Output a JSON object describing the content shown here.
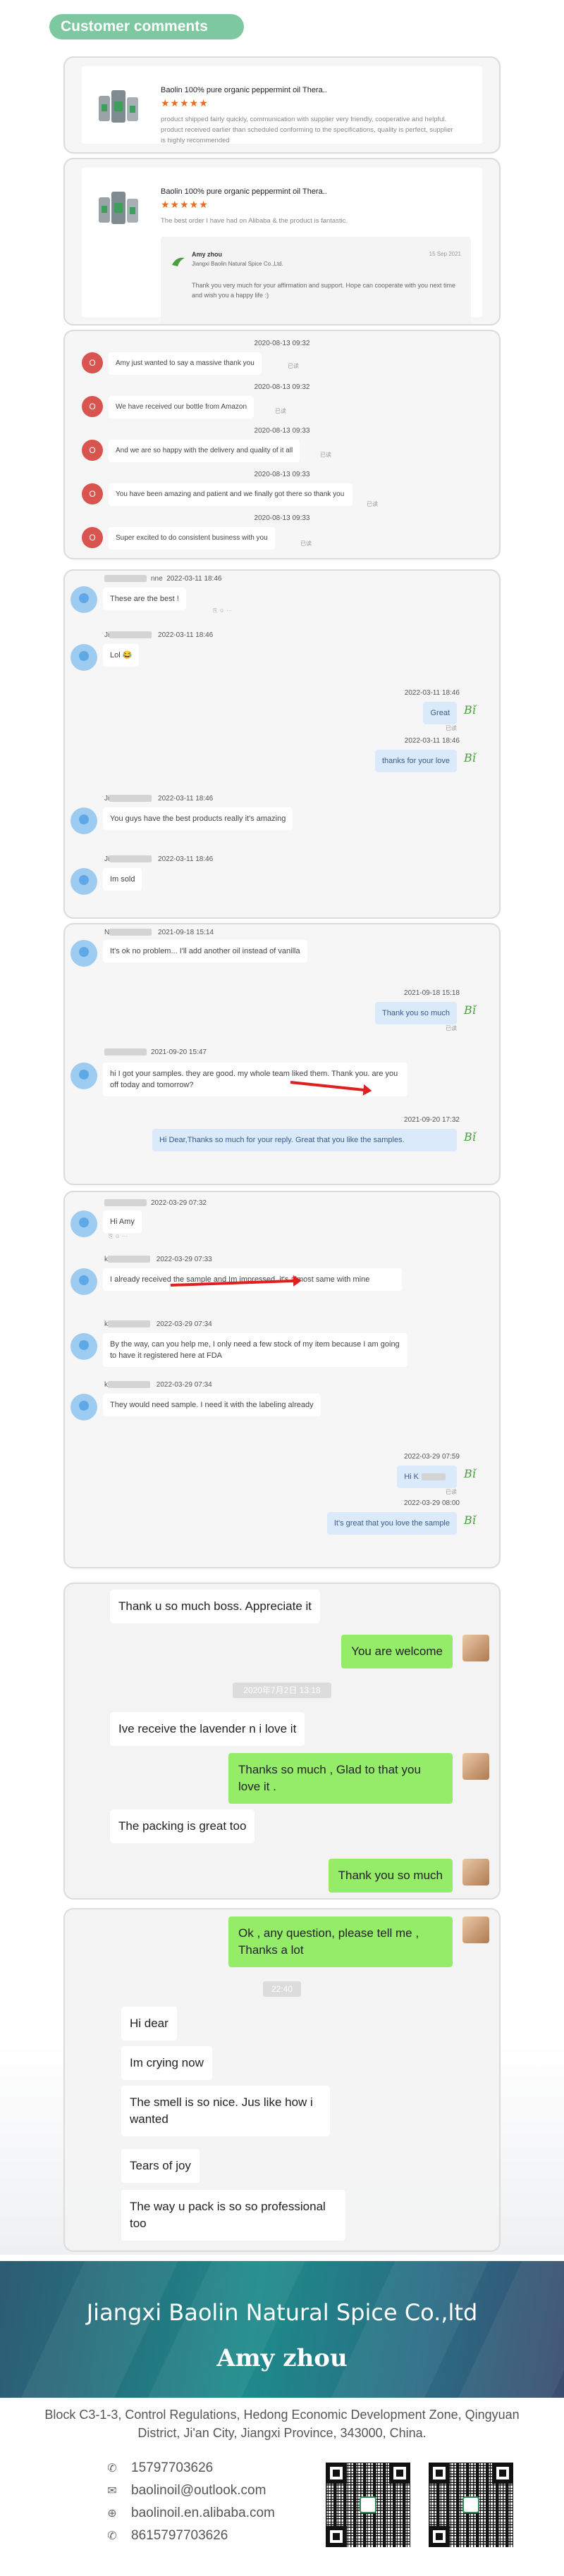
{
  "header": {
    "title": "Customer comments"
  },
  "reviews": [
    {
      "product": "Baolin 100% pure organic peppermint oil Thera..",
      "stars": "★★★★★",
      "text": "product shipped fairly quickly, communication with supplier very friendly, cooperative and helpful. product received earlier than scheduled conforming to the specifications, quality is perfect, supplier is highly recommended"
    },
    {
      "product": "Baolin 100% pure organic peppermint oil Thera..",
      "stars": "★★★★★",
      "text": "The best order I have had on Alibaba & the product is fantastic.",
      "reply": {
        "name": "Amy zhou",
        "company": "Jiangxi Baolin Natural Spice Co.,Ltd.",
        "date": "15 Sep 2021",
        "text": "Thank you very much for your affirmation and support. Hope can cooperate with you next time and wish you a happy life :)"
      }
    }
  ],
  "chat1": {
    "avatar_letter": "O",
    "read_label": "已读",
    "messages": [
      {
        "time": "2020-08-13 09:32",
        "text": "Amy just wanted to say a massive thank you"
      },
      {
        "time": "2020-08-13 09:32",
        "text": "We have received our bottle from Amazon"
      },
      {
        "time": "2020-08-13 09:33",
        "text": "And we are so happy with the delivery and quality of it all"
      },
      {
        "time": "2020-08-13 09:33",
        "text": "You have been amazing and patient and we finally got there so thank you"
      },
      {
        "time": "2020-08-13 09:33",
        "text": "Super excited to do consistent business with you"
      }
    ]
  },
  "chat2": {
    "sender_suffix": "nne",
    "logo_text": "Bǐ",
    "read_label": "已读",
    "m1_time": "2022-03-11 18:46",
    "m1": "These are the best !",
    "m2_prefix": "Ji",
    "m2_time": "2022-03-11 18:46",
    "m2": "Lol 😂",
    "m3_time": "2022-03-11 18:46",
    "m3": "Great",
    "m4_time": "2022-03-11 18:46",
    "m4": "thanks for your love",
    "m5_prefix": "Ji",
    "m5_time": "2022-03-11 18:46",
    "m5": "You guys have the best products really it's amazing",
    "m6_prefix": "Ji",
    "m6_time": "2022-03-11 18:46",
    "m6": "Im sold"
  },
  "chat3": {
    "sender_prefix": "N",
    "logo_text": "Bǐ",
    "read_label": "已读",
    "m1_time": "2021-09-18 15:14",
    "m1": "It's ok no problem... I'll add another oil instead of vanilla",
    "m2_time": "2021-09-18 15:18",
    "m2": "Thank you so much",
    "m3_time": "2021-09-20 15:47",
    "m3": "hi I got your samples. they are good. my whole team liked them. Thank you. are you off today and tomorrow?",
    "m4_time": "2021-09-20 17:32",
    "m4": "Hi Dear,Thanks so much for your reply. Great that you like the samples."
  },
  "chat4": {
    "logo_text": "Bǐ",
    "read_label": "已读",
    "m1_time": "2022-03-29 07:32",
    "m1": "Hi Amy",
    "m2_prefix": "k",
    "m2_time": "2022-03-29 07:33",
    "m2": "I already received the sample and Im impressed, it's almost same with mine",
    "m3_prefix": "k",
    "m3_time": "2022-03-29 07:34",
    "m3": "By the way, can you help me, I only need a few stock of my item because I am going to have it registered here at FDA",
    "m4_prefix": "k",
    "m4_time": "2022-03-29 07:34",
    "m4": "They would need sample. I need it with the labeling already",
    "m5_time": "2022-03-29 07:59",
    "m5": "Hi K",
    "m6_time": "2022-03-29 08:00",
    "m6": "It's great that you love the sample"
  },
  "chat5": {
    "m1": "Thank u so much boss. Appreciate it",
    "m2": "You are welcome",
    "time_pill": "2020年7月2日 13:18",
    "m3": "Ive receive the lavender n i love it",
    "m4": "Thanks so much , Glad to that you love it .",
    "m5": "The packing is great too",
    "m6": "Thank you  so much"
  },
  "chat6": {
    "m1": "Ok ,  any question, please tell me , Thanks a lot",
    "time_pill": "22:40",
    "m2": "Hi dear",
    "m3": "Im crying now",
    "m4": "The smell is so nice. Jus like how i wanted",
    "m5": "Tears of joy",
    "m6": "The way u pack is so so professional too"
  },
  "footer": {
    "company": "Jiangxi Baolin Natural Spice Co.,ltd",
    "person": "Amy zhou",
    "address": "Block C3-1-3, Control Regulations, Hedong Economic Development Zone, Qingyuan District, Ji'an City, Jiangxi Province, 343000, China.",
    "phone": "15797703626",
    "email": "baolinoil@outlook.com",
    "web": "baolinoil.en.alibaba.com",
    "whatsapp": "8615797703626"
  },
  "colors": {
    "accent_green": "#7dc8a0",
    "chat_green": "#95ec69",
    "chat_blue": "#dbeafb",
    "star_orange": "#f26a1b"
  }
}
